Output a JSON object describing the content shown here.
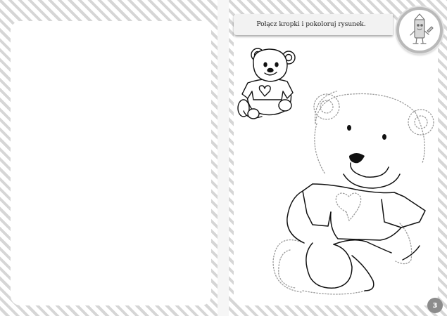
{
  "instruction": "Połącz kropki i pokoloruj rysunek.",
  "page_number": "3",
  "icons": {
    "badge": "crayon-character-icon",
    "example": "teddy-bear-example-illustration",
    "tracing": "teddy-bear-dotted-tracing"
  }
}
